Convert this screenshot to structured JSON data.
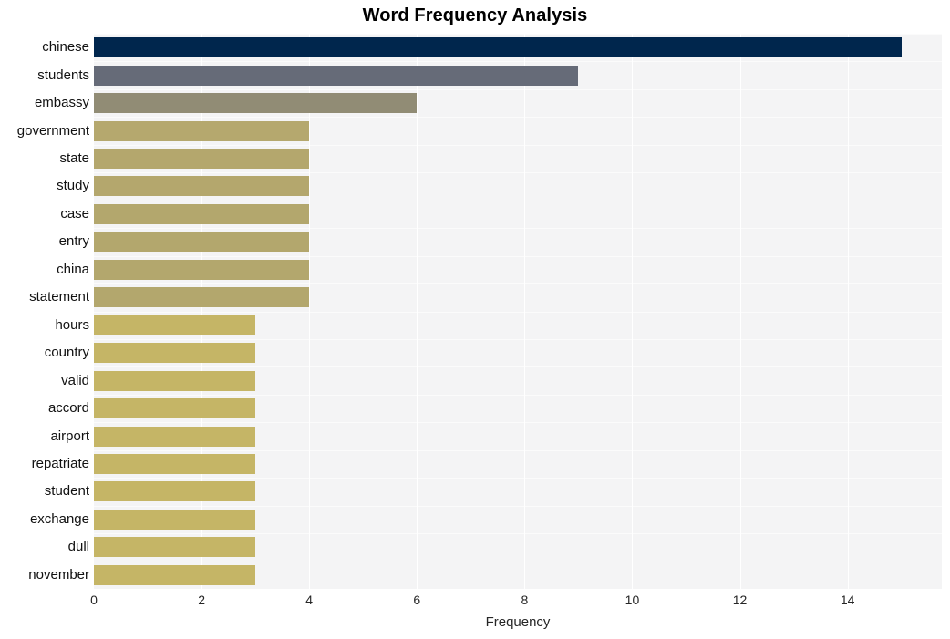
{
  "chart_data": {
    "type": "bar",
    "orientation": "horizontal",
    "title": "Word Frequency Analysis",
    "xlabel": "Frequency",
    "ylabel": "",
    "xlim": [
      0,
      15.75
    ],
    "xticks": [
      0,
      2,
      4,
      6,
      8,
      10,
      12,
      14
    ],
    "grid": true,
    "legend": "none",
    "categories": [
      "chinese",
      "students",
      "embassy",
      "government",
      "state",
      "study",
      "case",
      "entry",
      "china",
      "statement",
      "hours",
      "country",
      "valid",
      "accord",
      "airport",
      "repatriate",
      "student",
      "exchange",
      "dull",
      "november"
    ],
    "values": [
      15,
      9,
      6,
      4,
      4,
      4,
      4,
      4,
      4,
      4,
      3,
      3,
      3,
      3,
      3,
      3,
      3,
      3,
      3,
      3
    ],
    "bar_colors": [
      "#00264d",
      "#666b78",
      "#918c75",
      "#b5a86e",
      "#b4a76d",
      "#b4a76d",
      "#b3a76d",
      "#b3a76d",
      "#b3a76d",
      "#b3a76d",
      "#c5b566",
      "#c5b566",
      "#c5b566",
      "#c5b566",
      "#c5b566",
      "#c5b566",
      "#c5b566",
      "#c5b566",
      "#c5b566",
      "#c5b566"
    ]
  },
  "style": {
    "plot_background": "#f4f4f5",
    "grid_color": "#ffffff",
    "figure_background": "#ffffff",
    "tick_label_color": "#262626",
    "title_color": "#000000"
  }
}
